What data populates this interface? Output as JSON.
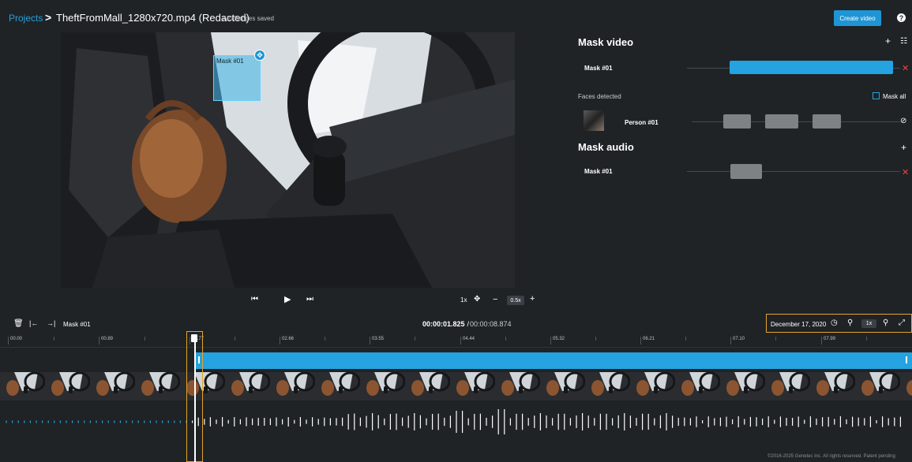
{
  "header": {
    "breadcrumb_link": "Projects",
    "breadcrumb_sep": ">",
    "file_title": "TheftFromMall_1280x720.mp4 (Redacted)",
    "save_status": "All changes saved",
    "create_button": "Create video",
    "help_icon": "?"
  },
  "video": {
    "mask_label": "Mask #01"
  },
  "player": {
    "skip_start_icon": "skip-start-icon",
    "play_icon": "play-icon",
    "skip_end_icon": "skip-end-icon",
    "zoom_level": "1x",
    "minus": "−",
    "speed": "0.5x",
    "plus": "+"
  },
  "mask_video": {
    "title": "Mask video",
    "plus": "+",
    "row_label": "Mask #01",
    "faces_label": "Faces detected",
    "mask_all_label": "Mask all",
    "person_label": "Person #01"
  },
  "mask_audio": {
    "title": "Mask audio",
    "plus": "+",
    "row_label": "Mask #01"
  },
  "timeline": {
    "mask_label": "Mask #01",
    "current_time": "00:00:01.825",
    "separator": " / ",
    "total_time": "00:00:08.874",
    "date": "December 17, 2020",
    "zoom": "1x",
    "ticks": [
      "00.00",
      "00.89",
      "01.77",
      "02.66",
      "03.55",
      "04.44",
      "05.32",
      "06.21",
      "07.10",
      "07.99"
    ]
  },
  "footer": {
    "copyright": "©2016-2025 Genetec Inc. All rights reserved. Patent pending"
  },
  "colors": {
    "accent": "#24a3e0",
    "highlight_outline": "#e3a52b",
    "delete": "#e84a4a",
    "background": "#1f2326"
  }
}
